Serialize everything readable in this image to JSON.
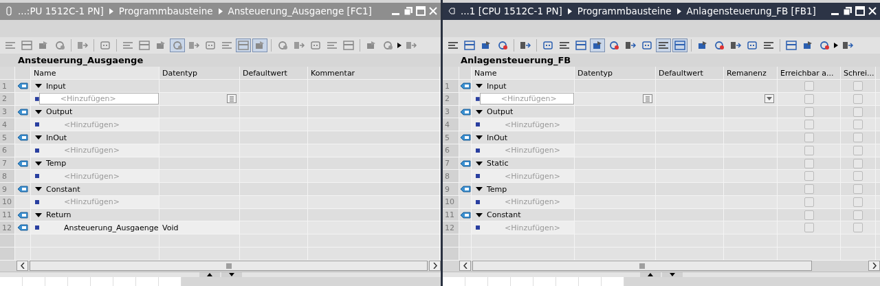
{
  "editors": [
    {
      "active": false,
      "breadcrumb": [
        "...:PU 1512C-1 PN]",
        "Programmbausteine",
        "Ansteuerung_Ausgaenge [FC1]"
      ],
      "toolbar": [
        {
          "kind": "tool",
          "pressed": false
        },
        {
          "kind": "tool",
          "pressed": false
        },
        {
          "kind": "tool",
          "pressed": false
        },
        {
          "kind": "tool",
          "pressed": false
        },
        {
          "kind": "separator"
        },
        {
          "kind": "tool",
          "pressed": false
        },
        {
          "kind": "separator"
        },
        {
          "kind": "tool",
          "pressed": false
        },
        {
          "kind": "separator"
        },
        {
          "kind": "tool",
          "pressed": false
        },
        {
          "kind": "tool",
          "pressed": false
        },
        {
          "kind": "tool",
          "pressed": false
        },
        {
          "kind": "tool",
          "pressed": true
        },
        {
          "kind": "tool",
          "pressed": false
        },
        {
          "kind": "tool",
          "pressed": false
        },
        {
          "kind": "tool",
          "pressed": false
        },
        {
          "kind": "tool",
          "pressed": true
        },
        {
          "kind": "tool",
          "pressed": true
        },
        {
          "kind": "separator"
        },
        {
          "kind": "tool",
          "pressed": false
        },
        {
          "kind": "tool",
          "pressed": false
        },
        {
          "kind": "tool",
          "pressed": false
        },
        {
          "kind": "tool",
          "pressed": false
        },
        {
          "kind": "tool",
          "pressed": false
        },
        {
          "kind": "separator"
        },
        {
          "kind": "tool",
          "pressed": false
        },
        {
          "kind": "tool",
          "pressed": false
        },
        {
          "kind": "more"
        },
        {
          "kind": "tool",
          "pressed": false
        }
      ],
      "block_name": "Ansteuerung_Ausgaenge",
      "columns": [
        "Name",
        "Datentyp",
        "Defaultwert",
        "Kommentar"
      ],
      "rows": [
        {
          "no": "1",
          "kind": "section",
          "name": "Input",
          "expanded": true
        },
        {
          "no": "2",
          "kind": "add",
          "placeholder": "<Hinzufügen>",
          "editing": true
        },
        {
          "no": "3",
          "kind": "section",
          "name": "Output",
          "expanded": true
        },
        {
          "no": "4",
          "kind": "add",
          "placeholder": "<Hinzufügen>",
          "editing": false
        },
        {
          "no": "5",
          "kind": "section",
          "name": "InOut",
          "expanded": true
        },
        {
          "no": "6",
          "kind": "add",
          "placeholder": "<Hinzufügen>",
          "editing": false
        },
        {
          "no": "7",
          "kind": "section",
          "name": "Temp",
          "expanded": true
        },
        {
          "no": "8",
          "kind": "add",
          "placeholder": "<Hinzufügen>",
          "editing": false
        },
        {
          "no": "9",
          "kind": "section",
          "name": "Constant",
          "expanded": true
        },
        {
          "no": "10",
          "kind": "add",
          "placeholder": "<Hinzufügen>",
          "editing": false
        },
        {
          "no": "11",
          "kind": "section",
          "name": "Return",
          "expanded": true
        },
        {
          "no": "12",
          "kind": "member",
          "name": "Ansteuerung_Ausgaenge",
          "datatype": "Void"
        }
      ]
    },
    {
      "active": true,
      "breadcrumb": [
        "...1 [CPU 1512C-1 PN]",
        "Programmbausteine",
        "Anlagensteuerung_FB [FB1]"
      ],
      "toolbar": [
        {
          "kind": "tool",
          "pressed": false
        },
        {
          "kind": "tool",
          "pressed": false
        },
        {
          "kind": "tool",
          "pressed": false
        },
        {
          "kind": "tool",
          "pressed": false
        },
        {
          "kind": "separator"
        },
        {
          "kind": "tool",
          "pressed": false
        },
        {
          "kind": "separator"
        },
        {
          "kind": "tool",
          "pressed": false
        },
        {
          "kind": "tool",
          "pressed": false
        },
        {
          "kind": "tool",
          "pressed": false
        },
        {
          "kind": "tool",
          "pressed": true
        },
        {
          "kind": "tool",
          "pressed": false
        },
        {
          "kind": "tool",
          "pressed": false
        },
        {
          "kind": "tool",
          "pressed": false
        },
        {
          "kind": "tool",
          "pressed": true
        },
        {
          "kind": "tool",
          "pressed": true
        },
        {
          "kind": "separator"
        },
        {
          "kind": "tool",
          "pressed": false
        },
        {
          "kind": "tool",
          "pressed": false
        },
        {
          "kind": "tool",
          "pressed": false
        },
        {
          "kind": "tool",
          "pressed": false
        },
        {
          "kind": "tool",
          "pressed": false
        },
        {
          "kind": "separator"
        },
        {
          "kind": "tool",
          "pressed": false
        },
        {
          "kind": "tool",
          "pressed": false
        },
        {
          "kind": "tool",
          "pressed": false
        },
        {
          "kind": "more"
        },
        {
          "kind": "tool",
          "pressed": false
        }
      ],
      "block_name": "Anlagensteuerung_FB",
      "columns": [
        "Name",
        "Datentyp",
        "Defaultwert",
        "Remanenz",
        "Erreichbar a...",
        "Schrei..."
      ],
      "rows": [
        {
          "no": "1",
          "kind": "section",
          "name": "Input",
          "expanded": true,
          "checks": [
            false,
            false
          ]
        },
        {
          "no": "2",
          "kind": "add",
          "placeholder": "<Hinzufügen>",
          "editing": true,
          "checks": [
            false,
            false
          ]
        },
        {
          "no": "3",
          "kind": "section",
          "name": "Output",
          "expanded": true,
          "checks": [
            false,
            false
          ]
        },
        {
          "no": "4",
          "kind": "add",
          "placeholder": "<Hinzufügen>",
          "editing": false,
          "checks": [
            false,
            false
          ]
        },
        {
          "no": "5",
          "kind": "section",
          "name": "InOut",
          "expanded": true,
          "checks": [
            false,
            false
          ]
        },
        {
          "no": "6",
          "kind": "add",
          "placeholder": "<Hinzufügen>",
          "editing": false,
          "checks": [
            false,
            false
          ]
        },
        {
          "no": "7",
          "kind": "section",
          "name": "Static",
          "expanded": true,
          "checks": [
            false,
            false
          ]
        },
        {
          "no": "8",
          "kind": "add",
          "placeholder": "<Hinzufügen>",
          "editing": false,
          "checks": [
            false,
            false
          ]
        },
        {
          "no": "9",
          "kind": "section",
          "name": "Temp",
          "expanded": true,
          "checks": [
            false,
            false
          ]
        },
        {
          "no": "10",
          "kind": "add",
          "placeholder": "<Hinzufügen>",
          "editing": false,
          "checks": [
            false,
            false
          ]
        },
        {
          "no": "11",
          "kind": "section",
          "name": "Constant",
          "expanded": true,
          "checks": [
            false,
            false
          ]
        },
        {
          "no": "12",
          "kind": "add",
          "placeholder": "<Hinzufügen>",
          "editing": false,
          "checks": [
            false,
            false
          ]
        }
      ]
    }
  ]
}
